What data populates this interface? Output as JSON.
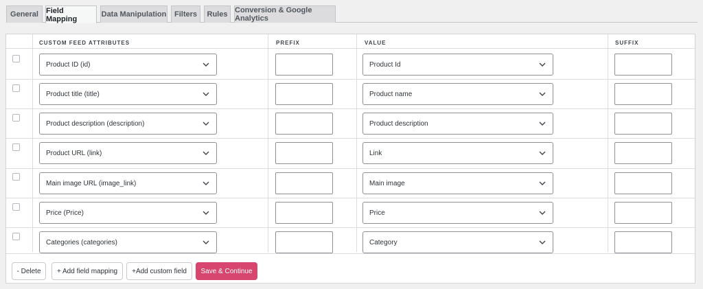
{
  "tabs": [
    {
      "label": "General"
    },
    {
      "label": "Field Mapping",
      "active": true
    },
    {
      "label": "Data Manipulation"
    },
    {
      "label": "Filters"
    },
    {
      "label": "Rules"
    },
    {
      "label": "Conversion & Google Analytics"
    }
  ],
  "table": {
    "headers": {
      "attributes": "CUSTOM FEED ATTRIBUTES",
      "prefix": "PREFIX",
      "value": "VALUE",
      "suffix": "SUFFIX"
    },
    "rows": [
      {
        "attribute": "Product ID (id)",
        "prefix": "",
        "value": "Product Id",
        "suffix": ""
      },
      {
        "attribute": "Product title (title)",
        "prefix": "",
        "value": "Product name",
        "suffix": ""
      },
      {
        "attribute": "Product description (description)",
        "prefix": "",
        "value": "Product description",
        "suffix": ""
      },
      {
        "attribute": "Product URL (link)",
        "prefix": "",
        "value": "Link",
        "suffix": ""
      },
      {
        "attribute": "Main image URL (image_link)",
        "prefix": "",
        "value": "Main image",
        "suffix": ""
      },
      {
        "attribute": "Price (Price)",
        "prefix": "",
        "value": "Price",
        "suffix": ""
      },
      {
        "attribute": "Categories (categories)",
        "prefix": "",
        "value": "Category",
        "suffix": ""
      }
    ]
  },
  "actions": {
    "delete": "- Delete",
    "add_field_mapping": "+ Add field mapping",
    "add_custom_field": "+Add custom field",
    "save_continue": "Save & Continue"
  },
  "colors": {
    "primary": "#d6466f",
    "background": "#f0f0f1",
    "tab_bg": "#dcdcde"
  }
}
